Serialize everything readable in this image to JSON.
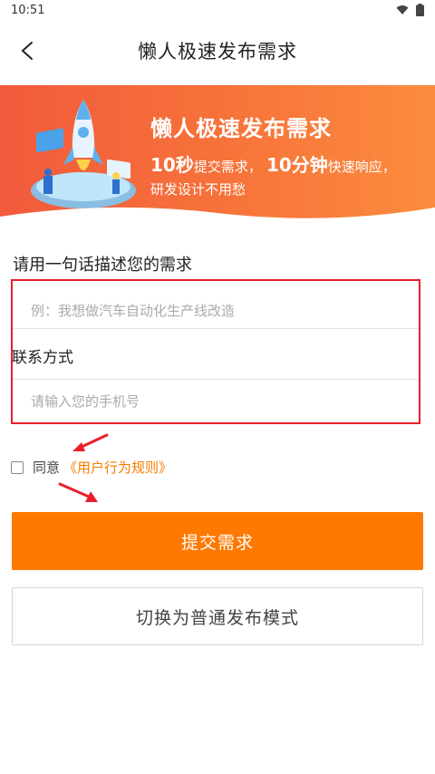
{
  "status_bar": {
    "time": "10:51"
  },
  "nav": {
    "title": "懒人极速发布需求"
  },
  "banner": {
    "title": "懒人极速发布需求",
    "line1_a": "10秒",
    "line1_b": "提交需求，",
    "line1_c": "10分钟",
    "line1_d": "快速响应，",
    "line2": "研发设计不用愁"
  },
  "form": {
    "section_label": "请用一句话描述您的需求",
    "need_placeholder": "例：我想做汽车自动化生产线改造",
    "contact_label": "联系方式",
    "phone_placeholder": "请输入您的手机号"
  },
  "agreement": {
    "prefix": "同意",
    "link": "《用户行为规则》",
    "checked": false
  },
  "actions": {
    "submit_label": "提交需求",
    "switch_label": "切换为普通发布模式"
  },
  "colors": {
    "accent": "#ff7800",
    "highlight_box": "#e8202a",
    "link": "#f57c00"
  }
}
